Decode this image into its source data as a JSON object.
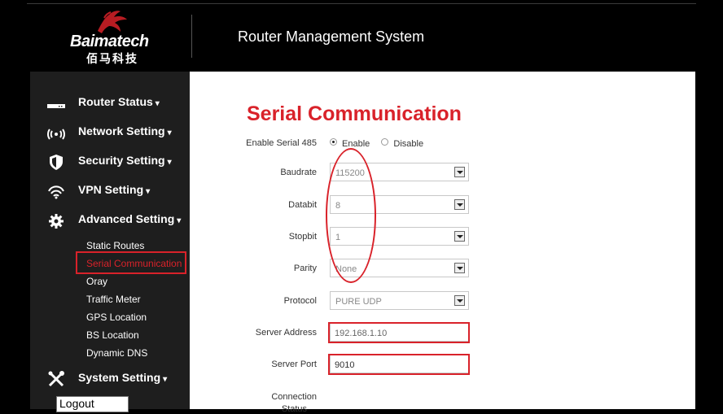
{
  "header": {
    "logo_text": "Baimatech",
    "logo_cn": "佰马科技",
    "title": "Router Management System"
  },
  "sidebar": {
    "items": [
      {
        "label": "Router Status",
        "icon": "router-icon"
      },
      {
        "label": "Network Setting",
        "icon": "wireless-icon"
      },
      {
        "label": "Security Setting",
        "icon": "shield-icon"
      },
      {
        "label": "VPN Setting",
        "icon": "vpn-icon"
      },
      {
        "label": "Advanced Setting",
        "icon": "gear-icon"
      },
      {
        "label": "System Setting",
        "icon": "tools-icon"
      }
    ],
    "caret": "▾",
    "sub_items": [
      "Static Routes",
      "Serial Communication",
      "Oray",
      "Traffic Meter",
      "GPS Location",
      "BS Location",
      "Dynamic DNS"
    ],
    "active_sub_item": "Serial Communication",
    "logout": "Logout"
  },
  "page": {
    "title": "Serial Communication",
    "enable_label": "Enable Serial 485",
    "enable_option": "Enable",
    "disable_option": "Disable",
    "enable_selected": "Enable",
    "baudrate_label": "Baudrate",
    "baudrate_value": "115200",
    "databit_label": "Databit",
    "databit_value": "8",
    "stopbit_label": "Stopbit",
    "stopbit_value": "1",
    "parity_label": "Parity",
    "parity_value": "None",
    "protocol_label": "Protocol",
    "protocol_value": "PURE UDP",
    "server_address_label": "Server Address",
    "server_address_value": "192.168.1.10",
    "server_port_label": "Server Port",
    "server_port_value": "9010",
    "connection_status_label_1": "Connection",
    "connection_status_label_2": "Status"
  },
  "colors": {
    "accent": "#d9222a",
    "sidebar_bg": "#1e1e1e",
    "header_bg": "#000000"
  }
}
